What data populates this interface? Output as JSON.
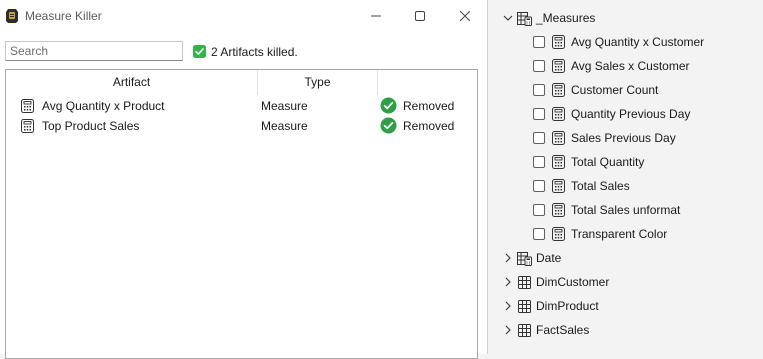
{
  "window": {
    "title": "Measure Killer",
    "search_placeholder": "Search",
    "status_text": "2 Artifacts killed."
  },
  "grid": {
    "headers": [
      "Artifact",
      "Type",
      ""
    ],
    "rows": [
      {
        "artifact": "Avg Quantity x Product",
        "type": "Measure",
        "status": "Removed"
      },
      {
        "artifact": "Top Product Sales",
        "type": "Measure",
        "status": "Removed"
      }
    ]
  },
  "fields": {
    "measures_table": "_Measures",
    "measures": [
      "Avg Quantity x Customer",
      "Avg Sales x Customer",
      "Customer Count",
      "Quantity Previous Day",
      "Sales Previous Day",
      "Total Quantity",
      "Total Sales",
      "Total Sales unformat",
      "Transparent Color"
    ],
    "tables": [
      "Date",
      "DimCustomer",
      "DimProduct",
      "FactSales"
    ]
  },
  "colors": {
    "success_green": "#2ea043",
    "checkbox_green": "#36b24a"
  },
  "icons": {
    "measure": "calculator-icon",
    "table": "table-icon",
    "success": "check-circle-icon"
  }
}
